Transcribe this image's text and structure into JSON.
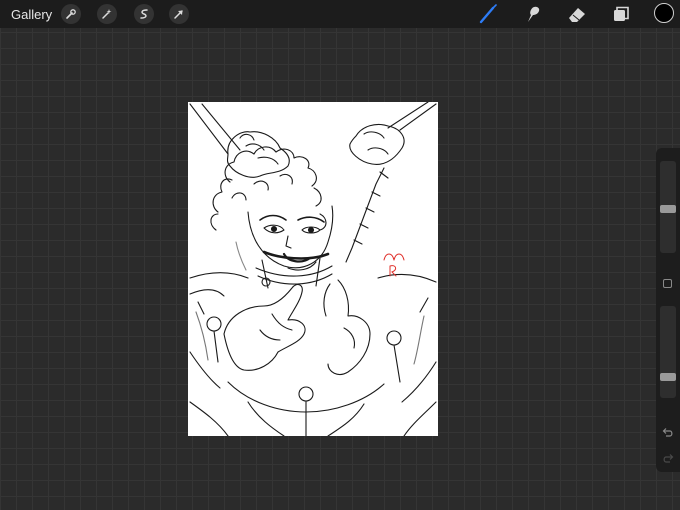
{
  "topbar": {
    "gallery_label": "Gallery",
    "left_tools": [
      "wrench-icon",
      "magic-wand-icon",
      "selection-icon",
      "transform-arrow-icon"
    ],
    "right_tools": [
      "brush-icon",
      "smudge-icon",
      "eraser-icon",
      "layers-icon"
    ],
    "active_tool": "brush-icon",
    "accent_color": "#2d7cf6",
    "current_color": "#000000"
  },
  "canvas": {
    "background": "#ffffff",
    "subject": "line-art-sketch",
    "stroke_color": "#1a1a1a",
    "red_mark_color": "#e0302b"
  },
  "sidebar": {
    "brush_size_level": 0.48,
    "opacity_level": 0.2,
    "icons": [
      "modify-square-icon",
      "undo-icon",
      "redo-icon"
    ]
  }
}
